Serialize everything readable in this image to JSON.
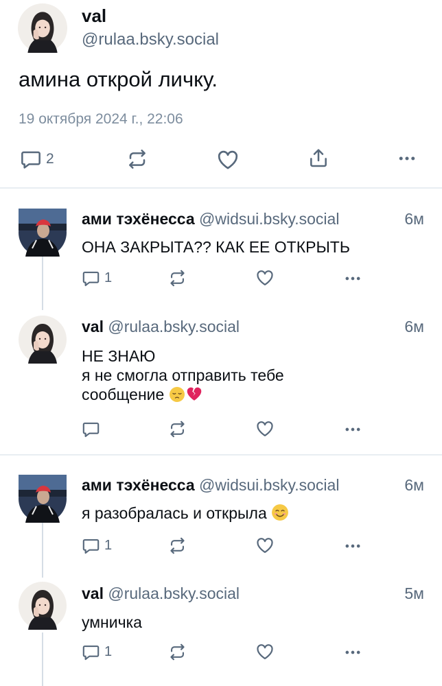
{
  "main_post": {
    "author_name": "val",
    "handle": "@rulaa.bsky.social",
    "text": "амина открой личку.",
    "date": "19 октября 2024 г., 22:06",
    "reply_count": "2"
  },
  "replies": [
    {
      "author_name": "ами тэхёнесса",
      "handle": "@widsui.bsky.social",
      "time": "6м",
      "lines": [
        "ОНА ЗАКРЫТА?? КАК ЕЕ ОТКРЫТЬ"
      ],
      "reply_count": "1"
    },
    {
      "author_name": "val",
      "handle": "@rulaa.bsky.social",
      "time": "6м",
      "lines": [
        "НЕ ЗНАЮ",
        "я не смогла отправить тебе",
        "сообщение"
      ],
      "reply_count": ""
    },
    {
      "author_name": "ами тэхёнесса",
      "handle": "@widsui.bsky.social",
      "time": "6м",
      "lines": [
        "я разобралась и открыла"
      ],
      "reply_count": "1"
    },
    {
      "author_name": "val",
      "handle": "@rulaa.bsky.social",
      "time": "5м",
      "lines": [
        "умничка"
      ],
      "reply_count": "1"
    }
  ],
  "emojis": [
    "pensive-face",
    "broken-heart",
    "smiling-face-with-smiling-eyes"
  ],
  "colors": {
    "text": "#0b0f14",
    "muted": "#58697c",
    "divider": "#e8edf2",
    "thread_line": "#d5dde5"
  }
}
